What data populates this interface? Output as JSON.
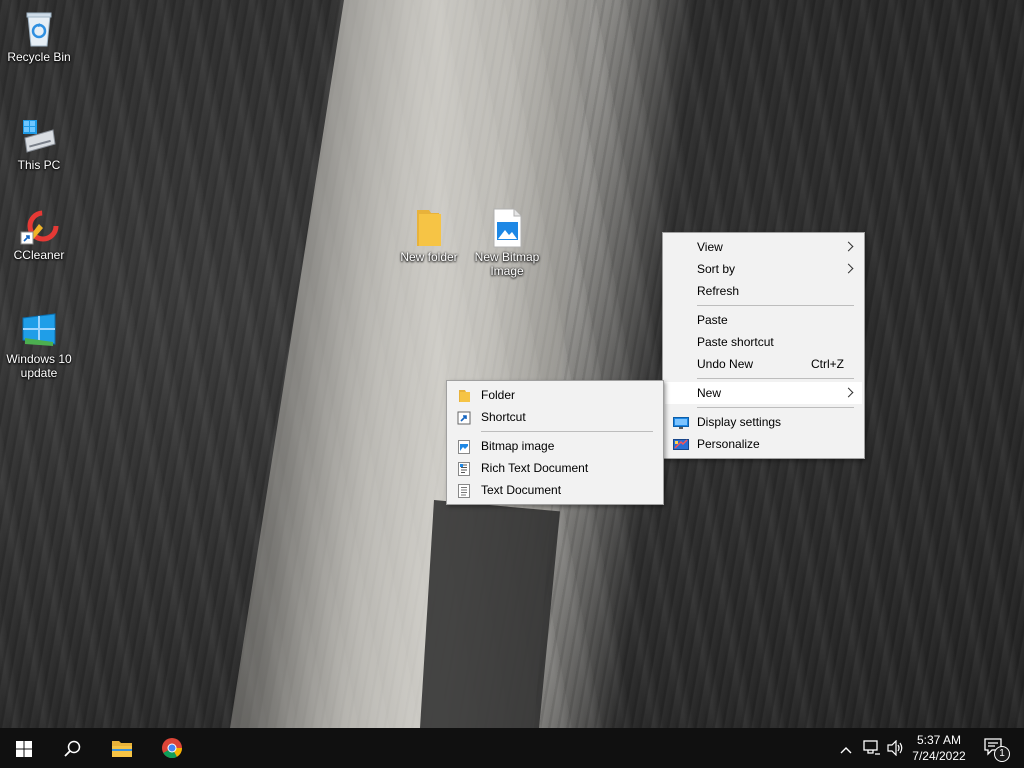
{
  "desktop": {
    "icons_left": [
      {
        "name": "recycle-bin",
        "label": "Recycle Bin",
        "icon": "recycle-bin-icon"
      },
      {
        "name": "this-pc",
        "label": "This PC",
        "icon": "computer-icon"
      },
      {
        "name": "ccleaner",
        "label": "CCleaner",
        "icon": "ccleaner-icon"
      },
      {
        "name": "windows-10-update",
        "label": "Windows 10 update",
        "icon": "windows-update-icon"
      }
    ],
    "icons_center": [
      {
        "name": "new-folder",
        "label": "New folder",
        "icon": "folder-icon"
      },
      {
        "name": "new-bitmap-image",
        "label": "New Bitmap Image",
        "icon": "bitmap-image-icon"
      }
    ]
  },
  "context_menu": {
    "items": [
      {
        "label": "View",
        "submenu": true
      },
      {
        "label": "Sort by",
        "submenu": true
      },
      {
        "label": "Refresh"
      },
      {
        "label": "Paste"
      },
      {
        "label": "Paste shortcut"
      },
      {
        "label": "Undo New",
        "shortcut": "Ctrl+Z"
      },
      {
        "label": "New",
        "submenu": true,
        "highlighted": true
      },
      {
        "label": "Display settings",
        "icon": "display-icon"
      },
      {
        "label": "Personalize",
        "icon": "personalize-icon"
      }
    ]
  },
  "new_submenu": {
    "items": [
      {
        "label": "Folder",
        "icon": "folder-icon"
      },
      {
        "label": "Shortcut",
        "icon": "shortcut-icon"
      },
      {
        "label": "Bitmap image",
        "icon": "bitmap-image-icon"
      },
      {
        "label": "Rich Text Document",
        "icon": "rich-text-icon"
      },
      {
        "label": "Text Document",
        "icon": "text-document-icon"
      }
    ]
  },
  "taskbar": {
    "start": "windows-start-icon",
    "search": "search-icon",
    "pinned": [
      "file-explorer-icon",
      "chrome-icon"
    ],
    "tray": {
      "time": "5:37 AM",
      "date": "7/24/2022",
      "notification_count": "1"
    }
  },
  "colors": {
    "menu_bg": "#f2f2f2",
    "menu_border": "#a0a0a0",
    "taskbar_bg": "#101010",
    "accent_blue": "#1e88e5",
    "folder_yellow": "#f6c445"
  }
}
